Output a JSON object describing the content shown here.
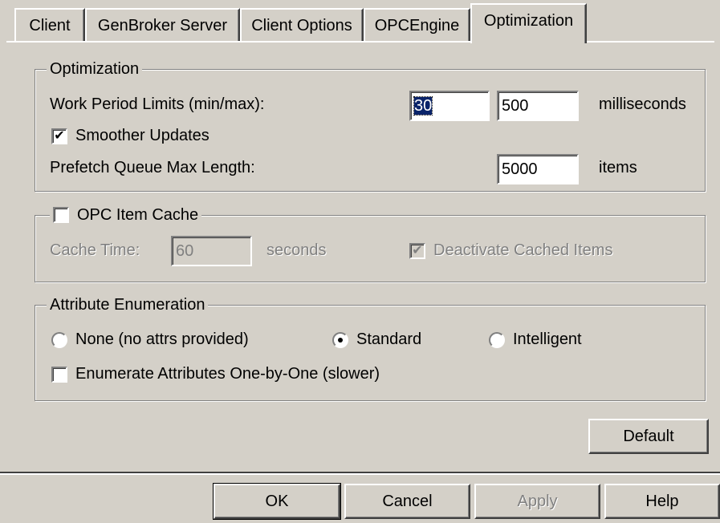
{
  "tabs": [
    {
      "label": "Client"
    },
    {
      "label": "GenBroker Server"
    },
    {
      "label": "Client Options"
    },
    {
      "label": "OPCEngine"
    },
    {
      "label": "Optimization"
    }
  ],
  "optimization": {
    "legend": "Optimization",
    "work_period_label": "Work Period Limits (min/max):",
    "work_period_min": "30",
    "work_period_max": "500",
    "work_period_unit": "milliseconds",
    "smoother_updates_label": "Smoother Updates",
    "smoother_updates_checked": true,
    "prefetch_label": "Prefetch Queue Max Length:",
    "prefetch_value": "5000",
    "prefetch_unit": "items"
  },
  "cache": {
    "legend": "OPC Item Cache",
    "enabled": false,
    "cache_time_label": "Cache Time:",
    "cache_time_value": "60",
    "cache_time_unit": "seconds",
    "deactivate_label": "Deactivate Cached Items",
    "deactivate_checked": true
  },
  "attr_enum": {
    "legend": "Attribute Enumeration",
    "options": [
      {
        "label": "None (no attrs provided)",
        "selected": false
      },
      {
        "label": "Standard",
        "selected": true
      },
      {
        "label": "Intelligent",
        "selected": false
      }
    ],
    "one_by_one_label": "Enumerate Attributes One-by-One (slower)",
    "one_by_one_checked": false
  },
  "buttons": {
    "default": "Default",
    "ok": "OK",
    "cancel": "Cancel",
    "apply": "Apply",
    "help": "Help"
  },
  "colors": {
    "face": "#d4d0c8",
    "selection": "#0a246a",
    "disabled_text": "#808080"
  }
}
